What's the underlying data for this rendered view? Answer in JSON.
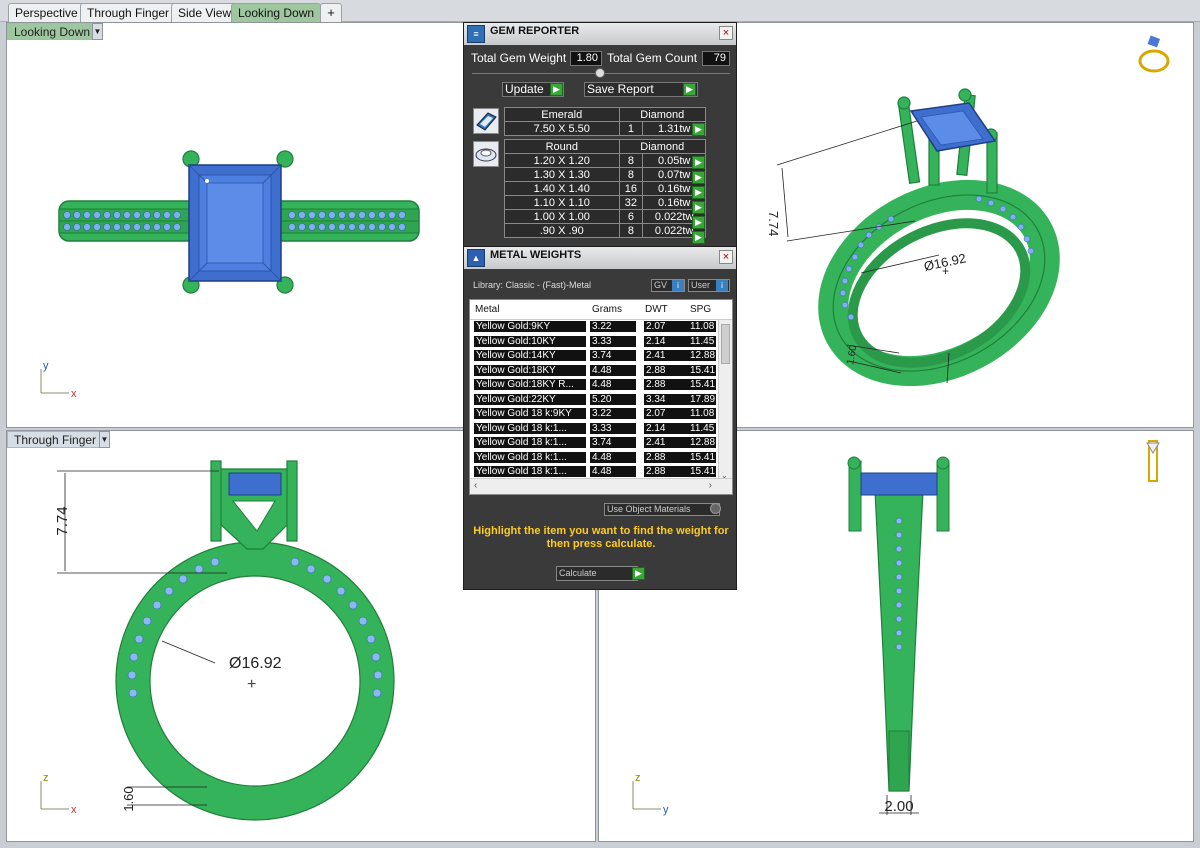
{
  "tabs": [
    {
      "label": "Perspective"
    },
    {
      "label": "Through Finger"
    },
    {
      "label": "Side View"
    },
    {
      "label": "Looking Down"
    }
  ],
  "add_tab_label": "+",
  "viewports": {
    "top_left": {
      "label": "Looking Down"
    },
    "bottom_left": {
      "label": "Through Finger"
    }
  },
  "axes": {
    "x": "x",
    "y": "y",
    "z": "z"
  },
  "dimensions": {
    "height_1": "7.74",
    "height_2": "7.74",
    "diameter_1": "Ø16.92",
    "diameter_2": "Ø16.92",
    "shank_1": "1.60",
    "shank_2": "1.60",
    "width": "2.00"
  },
  "gem_reporter": {
    "title": "GEM REPORTER",
    "close": "×",
    "total_weight_label": "Total Gem Weight",
    "total_weight_value": "1.80",
    "total_count_label": "Total Gem Count",
    "total_count_value": "79",
    "update_label": "Update",
    "save_report_label": "Save Report",
    "groups": [
      {
        "cut": "Emerald",
        "stone": "Diamond",
        "rows": [
          {
            "size": "7.50 X 5.50",
            "count": "1",
            "weight": "1.31tw"
          }
        ]
      },
      {
        "cut": "Round",
        "stone": "Diamond",
        "rows": [
          {
            "size": "1.20 X 1.20",
            "count": "8",
            "weight": "0.05tw"
          },
          {
            "size": "1.30 X 1.30",
            "count": "8",
            "weight": "0.07tw"
          },
          {
            "size": "1.40 X 1.40",
            "count": "16",
            "weight": "0.16tw"
          },
          {
            "size": "1.10 X 1.10",
            "count": "32",
            "weight": "0.16tw"
          },
          {
            "size": "1.00 X 1.00",
            "count": "6",
            "weight": "0.022tw"
          },
          {
            "size": ".90 X .90",
            "count": "8",
            "weight": "0.022tw"
          }
        ]
      }
    ]
  },
  "metal_weights": {
    "title": "METAL WEIGHTS",
    "close": "×",
    "library": "Library: Classic - (Fast)-Metal",
    "gv_label": "GV",
    "user_label": "User",
    "info_glyph": "i",
    "columns": [
      "Metal",
      "Grams",
      "DWT",
      "SPG"
    ],
    "rows": [
      [
        "Yellow Gold:9KY",
        "3.22",
        "2.07",
        "11.08"
      ],
      [
        "Yellow Gold:10KY",
        "3.33",
        "2.14",
        "11.45"
      ],
      [
        "Yellow Gold:14KY",
        "3.74",
        "2.41",
        "12.88"
      ],
      [
        "Yellow Gold:18KY",
        "4.48",
        "2.88",
        "15.41"
      ],
      [
        "Yellow Gold:18KY R...",
        "4.48",
        "2.88",
        "15.41"
      ],
      [
        "Yellow Gold:22KY",
        "5.20",
        "3.34",
        "17.89"
      ],
      [
        "Yellow Gold 18 k:9KY",
        "3.22",
        "2.07",
        "11.08"
      ],
      [
        "Yellow Gold 18 k:1...",
        "3.33",
        "2.14",
        "11.45"
      ],
      [
        "Yellow Gold 18 k:1...",
        "3.74",
        "2.41",
        "12.88"
      ],
      [
        "Yellow Gold 18 k:1...",
        "4.48",
        "2.88",
        "15.41"
      ],
      [
        "Yellow Gold 18 k:1...",
        "4.48",
        "2.88",
        "15.41"
      ]
    ],
    "use_object_materials": "Use Object Materials",
    "hint": "Highlight the item you want to find the weight for then press calculate.",
    "calculate_label": "Calculate"
  },
  "colors": {
    "metal": "#35b35a",
    "metal_dark": "#1f7f3a",
    "gem": "#4a78d6",
    "gem_accent": "#9cc3f2",
    "active_tab": "#9fc79f",
    "panel_bg": "#3a3a3a",
    "hint": "#ffcc1a"
  }
}
